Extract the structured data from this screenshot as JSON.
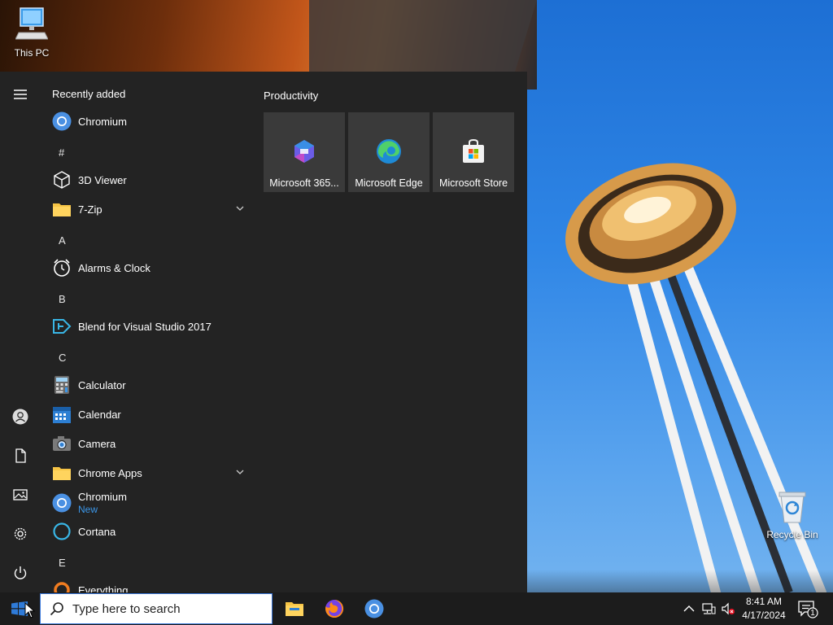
{
  "desktop": {
    "icons": [
      {
        "label": "This PC",
        "icon": "computer-icon"
      },
      {
        "label": "Recycle Bin",
        "icon": "recycle-bin-icon"
      }
    ]
  },
  "start_menu": {
    "rail": [
      {
        "icon": "hamburger-menu-icon"
      },
      {
        "icon": "user-account-icon"
      },
      {
        "icon": "documents-icon"
      },
      {
        "icon": "pictures-icon"
      },
      {
        "icon": "settings-gear-icon"
      },
      {
        "icon": "power-icon"
      }
    ],
    "recently_added_label": "Recently added",
    "letters": [
      "#",
      "A",
      "B",
      "C",
      "E"
    ],
    "apps": [
      {
        "label": "Chromium",
        "icon": "chromium-icon"
      },
      {
        "label": "3D Viewer",
        "icon": "cube-icon"
      },
      {
        "label": "7-Zip",
        "icon": "folder-icon",
        "expandable": true
      },
      {
        "label": "Alarms & Clock",
        "icon": "alarm-clock-icon"
      },
      {
        "label": "Blend for Visual Studio 2017",
        "icon": "blend-icon"
      },
      {
        "label": "Calculator",
        "icon": "calculator-icon"
      },
      {
        "label": "Calendar",
        "icon": "calendar-icon"
      },
      {
        "label": "Camera",
        "icon": "camera-icon"
      },
      {
        "label": "Chrome Apps",
        "icon": "folder-icon",
        "expandable": true
      },
      {
        "label": "Chromium",
        "sub": "New",
        "icon": "chromium-icon"
      },
      {
        "label": "Cortana",
        "icon": "cortana-icon"
      },
      {
        "label": "Everything",
        "icon": "everything-icon"
      }
    ],
    "tiles_group": "Productivity",
    "tiles": [
      {
        "label": "Microsoft 365...",
        "icon": "microsoft-365-icon"
      },
      {
        "label": "Microsoft Edge",
        "icon": "edge-icon"
      },
      {
        "label": "Microsoft Store",
        "icon": "store-icon"
      }
    ]
  },
  "taskbar": {
    "search_placeholder": "Type here to search",
    "pinned": [
      {
        "icon": "file-explorer-icon"
      },
      {
        "icon": "firefox-icon"
      },
      {
        "icon": "chromium-icon"
      }
    ],
    "clock_time": "8:41 AM",
    "clock_date": "4/17/2024",
    "notification_count": "1"
  },
  "colors": {
    "start_bg": "#232323",
    "tile_bg": "#3a3a3a",
    "taskbar_bg": "#1c1c1c",
    "accent": "#3b96e8"
  }
}
